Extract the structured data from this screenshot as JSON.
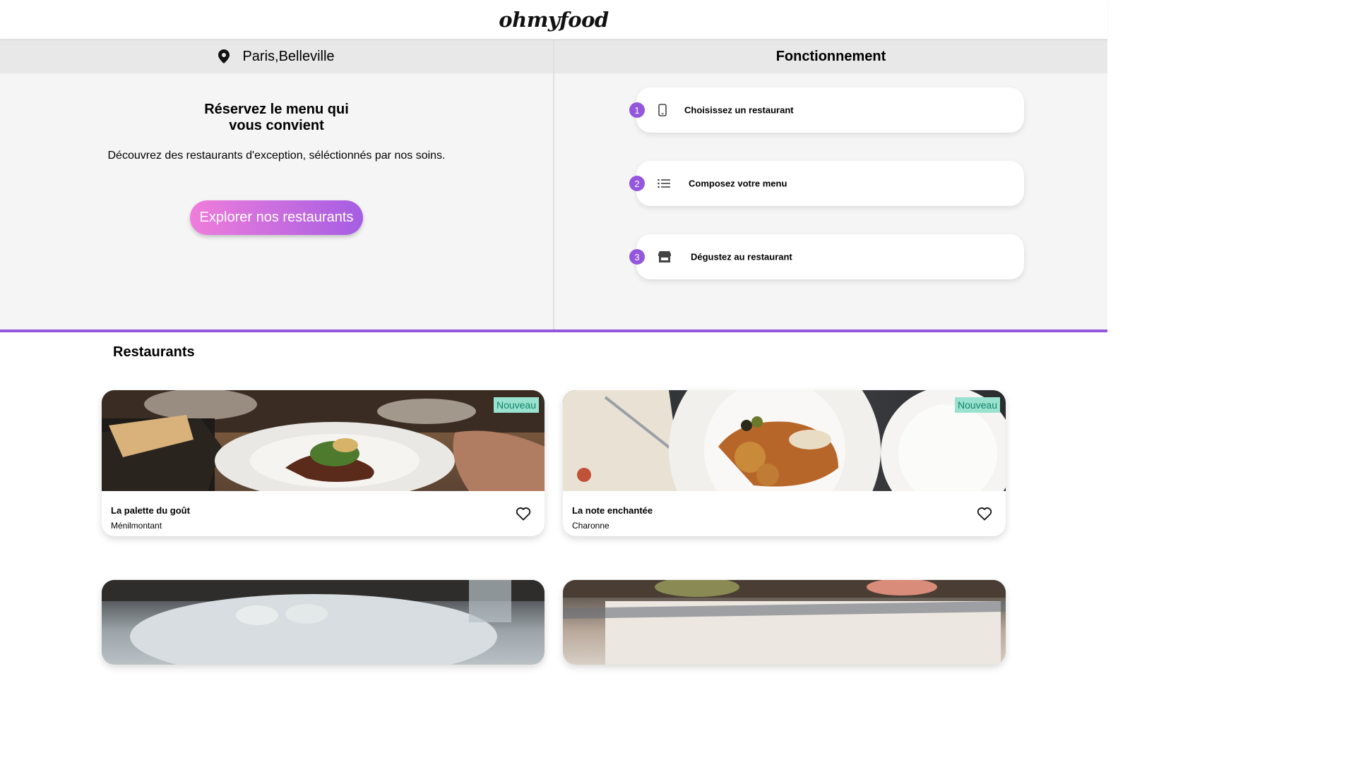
{
  "header": {
    "logo": "ohmyfood"
  },
  "location": {
    "text": "Paris,Belleville"
  },
  "hero": {
    "title": "Réservez le menu qui vous convient",
    "subtitle": "Découvrez des restaurants d'exception, séléctionnés par nos soins.",
    "cta_label": "Explorer nos restaurants"
  },
  "how": {
    "title": "Fonctionnement",
    "steps": [
      {
        "num": "1",
        "label": "Choisissez un restaurant",
        "icon": "phone-icon"
      },
      {
        "num": "2",
        "label": "Composez votre menu",
        "icon": "list-icon"
      },
      {
        "num": "3",
        "label": "Dégustez au restaurant",
        "icon": "store-icon"
      }
    ]
  },
  "restaurants": {
    "title": "Restaurants",
    "items": [
      {
        "name": "La palette du goût",
        "location": "Ménilmontant",
        "badge": "Nouveau"
      },
      {
        "name": "La note enchantée",
        "location": "Charonne",
        "badge": "Nouveau"
      },
      {
        "name": "",
        "location": "",
        "badge": ""
      },
      {
        "name": "",
        "location": "",
        "badge": ""
      }
    ]
  },
  "colors": {
    "accent": "#9356dc",
    "cta_start": "#ef7ddb",
    "cta_end": "#a55ee3",
    "badge_bg": "#99e2d0",
    "badge_text": "#138266"
  }
}
